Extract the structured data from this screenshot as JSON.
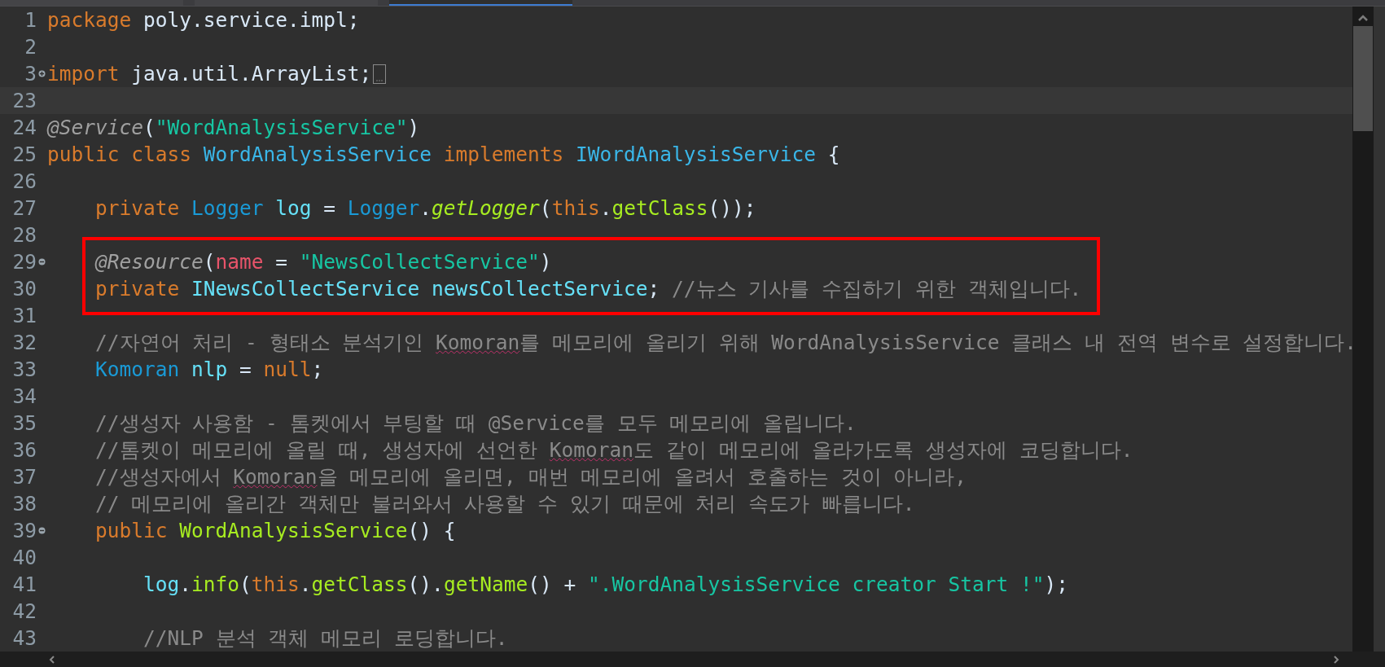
{
  "tabs": [
    {
      "selected": false
    },
    {
      "selected": false
    },
    {
      "selected": true
    }
  ],
  "lines": [
    {
      "number": "1",
      "tokens": [
        {
          "kind": "keyword",
          "text": "package "
        },
        {
          "kind": "plain",
          "text": "poly.service.impl;"
        }
      ]
    },
    {
      "number": "2"
    },
    {
      "number": "3",
      "folded": true,
      "tokens": [
        {
          "kind": "keyword",
          "text": "import "
        },
        {
          "kind": "plain",
          "text": "java.util.ArrayList;"
        }
      ]
    },
    {
      "number": "23",
      "current": true
    },
    {
      "number": "24",
      "tokens": [
        {
          "kind": "annotation",
          "text": "@Service"
        },
        {
          "kind": "plain",
          "text": "("
        },
        {
          "kind": "string",
          "text": "\"WordAnalysisService\""
        },
        {
          "kind": "plain",
          "text": ")"
        }
      ]
    },
    {
      "number": "25",
      "tokens": [
        {
          "kind": "keyword",
          "text": "public class "
        },
        {
          "kind": "class",
          "text": "WordAnalysisService "
        },
        {
          "kind": "keyword",
          "text": "implements "
        },
        {
          "kind": "class",
          "text": "IWordAnalysisService "
        },
        {
          "kind": "plain",
          "text": "{"
        }
      ]
    },
    {
      "number": "26"
    },
    {
      "number": "27",
      "tokens": [
        {
          "kind": "keyword",
          "text": "    private "
        },
        {
          "kind": "type",
          "text": "Logger "
        },
        {
          "kind": "field",
          "text": "log"
        },
        {
          "kind": "plain",
          "text": " = "
        },
        {
          "kind": "type",
          "text": "Logger"
        },
        {
          "kind": "plain",
          "text": "."
        },
        {
          "kind": "static_method",
          "text": "getLogger"
        },
        {
          "kind": "plain",
          "text": "("
        },
        {
          "kind": "keyword",
          "text": "this"
        },
        {
          "kind": "plain",
          "text": "."
        },
        {
          "kind": "method",
          "text": "getClass"
        },
        {
          "kind": "plain",
          "text": "());"
        }
      ]
    },
    {
      "number": "28"
    },
    {
      "number": "29",
      "folded": false,
      "boxed": true,
      "tokens": [
        {
          "kind": "annotation",
          "text": "    @Resource"
        },
        {
          "kind": "plain",
          "text": "("
        },
        {
          "kind": "parameter",
          "text": "name"
        },
        {
          "kind": "plain",
          "text": " = "
        },
        {
          "kind": "string",
          "text": "\"NewsCollectService\""
        },
        {
          "kind": "plain",
          "text": ")"
        }
      ]
    },
    {
      "number": "30",
      "boxed": true,
      "tokens": [
        {
          "kind": "keyword",
          "text": "    private "
        },
        {
          "kind": "field",
          "text": "INewsCollectService newsCollectService"
        },
        {
          "kind": "plain",
          "text": "; "
        },
        {
          "kind": "comment",
          "text": "//뉴스 기사를 수집하기 위한 객체입니다."
        }
      ]
    },
    {
      "number": "31"
    },
    {
      "number": "32",
      "tokens": [
        {
          "kind": "comment",
          "text": "    //자연어 처리 - 형태소 분석기인 "
        },
        {
          "kind": "misspelled",
          "text": "Komoran"
        },
        {
          "kind": "comment",
          "text": "를 메모리에 올리기 위해 WordAnalysisService 클래스 내 전역 변수로 설정합니다."
        }
      ]
    },
    {
      "number": "33",
      "tokens": [
        {
          "kind": "type",
          "text": "    Komoran "
        },
        {
          "kind": "field",
          "text": "nlp"
        },
        {
          "kind": "plain",
          "text": " = "
        },
        {
          "kind": "keyword",
          "text": "null"
        },
        {
          "kind": "plain",
          "text": ";"
        }
      ]
    },
    {
      "number": "34"
    },
    {
      "number": "35",
      "tokens": [
        {
          "kind": "comment",
          "text": "    //생성자 사용함 - 톰켓에서 부팅할 때 @Service를 모두 메모리에 올립니다."
        }
      ]
    },
    {
      "number": "36",
      "tokens": [
        {
          "kind": "comment",
          "text": "    //톰켓이 메모리에 올릴 때, 생성자에 선언한 "
        },
        {
          "kind": "misspelled",
          "text": "Komoran"
        },
        {
          "kind": "comment",
          "text": "도 같이 메모리에 올라가도록 생성자에 코딩합니다."
        }
      ]
    },
    {
      "number": "37",
      "tokens": [
        {
          "kind": "comment",
          "text": "    //생성자에서 "
        },
        {
          "kind": "misspelled",
          "text": "Komoran"
        },
        {
          "kind": "comment",
          "text": "을 메모리에 올리면, 매번 메모리에 올려서 호출하는 것이 아니라,"
        }
      ]
    },
    {
      "number": "38",
      "tokens": [
        {
          "kind": "comment",
          "text": "    // 메모리에 올리간 객체만 불러와서 사용할 수 있기 때문에 처리 속도가 빠릅니다."
        }
      ]
    },
    {
      "number": "39",
      "folded": false,
      "tokens": [
        {
          "kind": "keyword",
          "text": "    public "
        },
        {
          "kind": "method",
          "text": "WordAnalysisService"
        },
        {
          "kind": "plain",
          "text": "() {"
        }
      ]
    },
    {
      "number": "40"
    },
    {
      "number": "41",
      "tokens": [
        {
          "kind": "field",
          "text": "        log"
        },
        {
          "kind": "plain",
          "text": "."
        },
        {
          "kind": "method",
          "text": "info"
        },
        {
          "kind": "plain",
          "text": "("
        },
        {
          "kind": "keyword",
          "text": "this"
        },
        {
          "kind": "plain",
          "text": "."
        },
        {
          "kind": "method",
          "text": "getClass"
        },
        {
          "kind": "plain",
          "text": "()."
        },
        {
          "kind": "method",
          "text": "getName"
        },
        {
          "kind": "plain",
          "text": "() + "
        },
        {
          "kind": "string",
          "text": "\".WordAnalysisService creator Start !\""
        },
        {
          "kind": "plain",
          "text": ");"
        }
      ]
    },
    {
      "number": "42"
    },
    {
      "number": "43",
      "tokens": [
        {
          "kind": "comment",
          "text": "        //NLP 분석 객체 메모리 로딩합니다."
        }
      ]
    }
  ]
}
